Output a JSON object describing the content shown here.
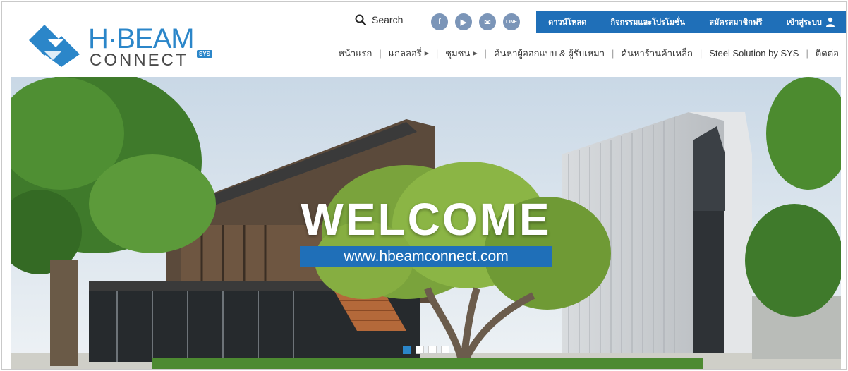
{
  "logo": {
    "top": "H·BEAM",
    "bottom": "CONNECT",
    "badge": "SYS"
  },
  "search": {
    "label": "Search"
  },
  "social": [
    {
      "name": "facebook-icon",
      "glyph": "f"
    },
    {
      "name": "youtube-icon",
      "glyph": "▶"
    },
    {
      "name": "email-icon",
      "glyph": "✉"
    },
    {
      "name": "line-icon",
      "glyph": "LINE"
    }
  ],
  "topbar": {
    "download": "ดาวน์โหลด",
    "promotions": "กิจกรรมและโปรโมชั่น",
    "register": "สมัครสมาชิกฟรี",
    "login": "เข้าสู่ระบบ"
  },
  "nav": {
    "home": "หน้าแรก",
    "gallery": "แกลลอรี่",
    "community": "ชุมชน",
    "find_designer": "ค้นหาผู้ออกแบบ & ผู้รับเหมา",
    "find_store": "ค้นหาร้านค้าเหล็ก",
    "steel_solution": "Steel Solution by SYS",
    "contact": "ติดต่อ"
  },
  "hero": {
    "title": "WELCOME",
    "url": "www.hbeamconnect.com",
    "slide_count": 4,
    "active_slide": 1
  },
  "colors": {
    "brand_blue": "#1f6fb8",
    "logo_blue": "#2b86c9"
  }
}
